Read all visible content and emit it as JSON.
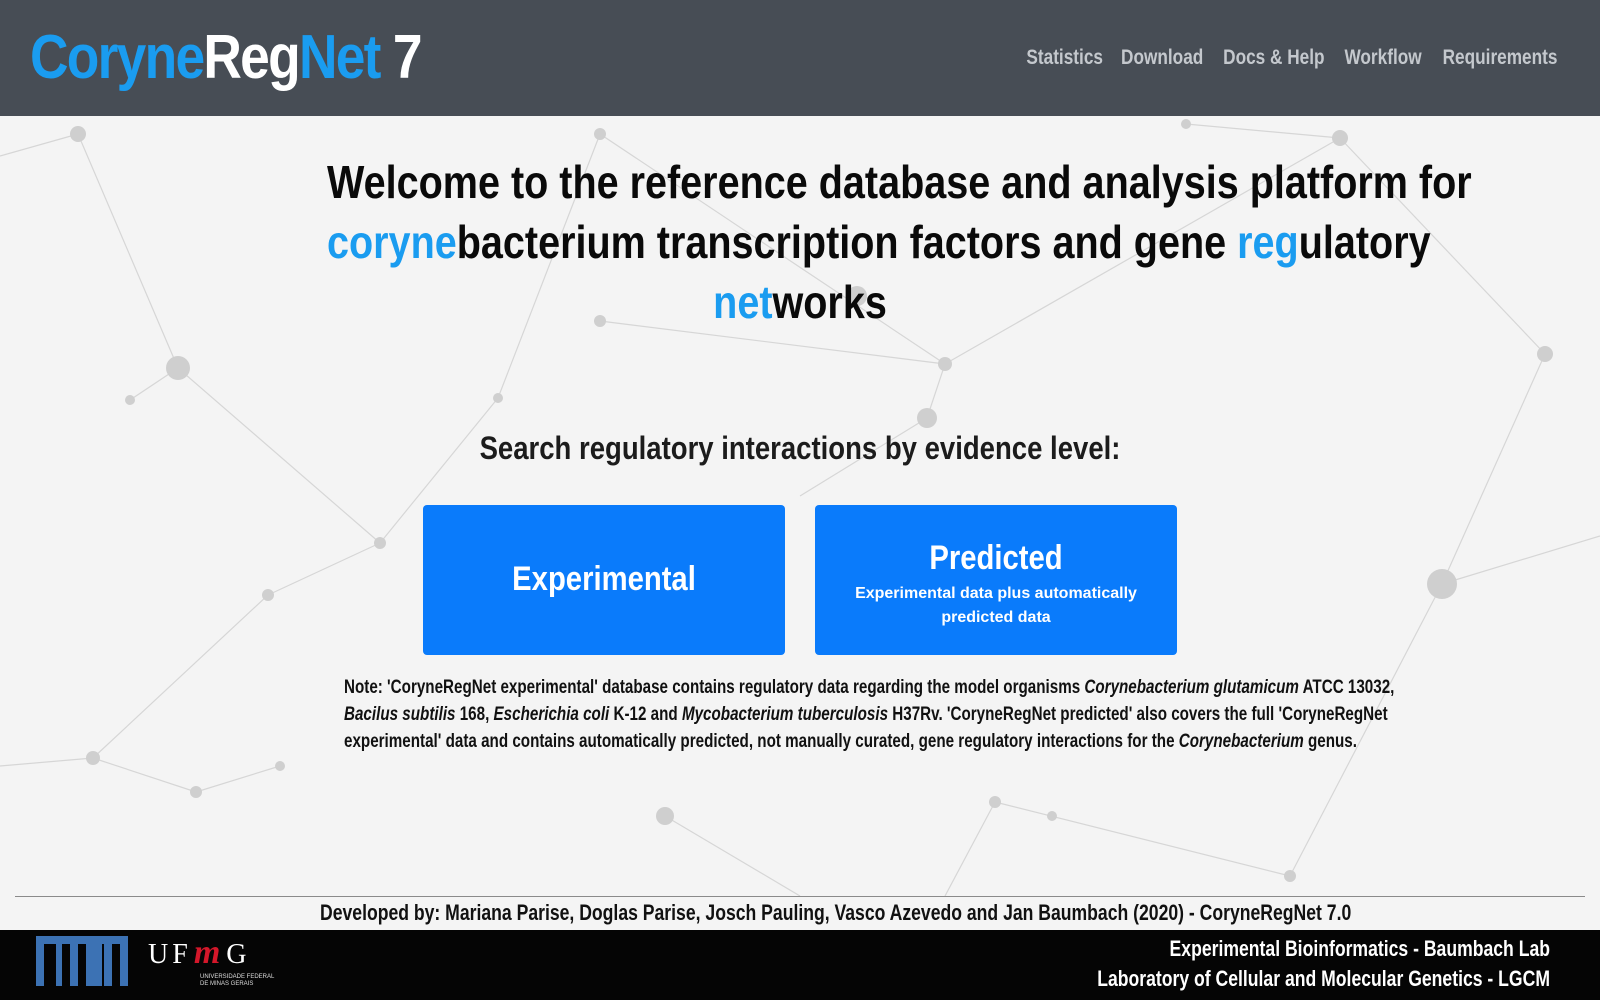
{
  "header": {
    "logo": {
      "part1": "Coryne",
      "part2": "Reg",
      "part3": "Net",
      "part4": "7"
    },
    "nav": [
      {
        "label": "Statistics"
      },
      {
        "label": "Download"
      },
      {
        "label": "Docs & Help"
      },
      {
        "label": "Workflow"
      },
      {
        "label": "Requirements"
      }
    ]
  },
  "welcome": {
    "line1": "Welcome to the reference database and analysis platform for",
    "coryne": "coryne",
    "line2_mid": "bacterium transcription factors and gene ",
    "reg": "reg",
    "line2_end": "ulatory",
    "net": "net",
    "line3_end": "works"
  },
  "search": {
    "heading": "Search regulatory interactions by evidence level:",
    "experimental_label": "Experimental",
    "predicted_label": "Predicted",
    "predicted_sub": "Experimental data plus automatically predicted data"
  },
  "note": {
    "l1_a": "Note: 'CoryneRegNet experimental' database contains regulatory data regarding the model organisms ",
    "l1_i": "Corynebacterium glutamicum",
    "l1_b": " ATCC 13032,",
    "l2_i1": "Bacilus subtilis",
    "l2_a": " 168, ",
    "l2_i2": "Escherichia coli",
    "l2_b": " K-12 and ",
    "l2_i3": "Mycobacterium tuberculosis",
    "l2_c": " H37Rv. 'CoryneRegNet predicted' also covers the full 'CoryneRegNet",
    "l3_a": "experimental' data and contains automatically predicted, not manually curated, gene regulatory interactions for the ",
    "l3_i": "Corynebacterium",
    "l3_b": " genus."
  },
  "developed_by": "Developed by: Mariana Parise, Doglas Parise, Josch Pauling, Vasco Azevedo and Jan Baumbach (2020) - CoryneRegNet 7.0",
  "footer": {
    "ufmg_u": "U",
    "ufmg_f": "F",
    "ufmg_m": "m",
    "ufmg_g": "G",
    "ufmg_sub1": "UNIVERSIDADE FEDERAL",
    "ufmg_sub2": "DE MINAS GERAIS",
    "line1": "Experimental Bioinformatics - Baumbach Lab",
    "line2": "Laboratory of Cellular and Molecular Genetics - LGCM"
  },
  "colors": {
    "header_bg": "#474d55",
    "accent_blue": "#1a9cf0",
    "button_blue": "#0a7bfb",
    "tum_blue": "#3c72b4",
    "ufmg_red": "#d4172a",
    "footer_bg": "#050505"
  }
}
